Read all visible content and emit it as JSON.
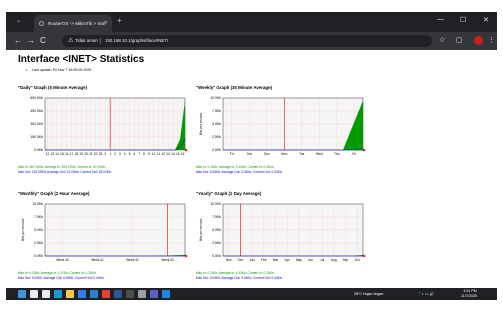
{
  "browser": {
    "tab_title": "RouterOS -> MikroTik > Inte",
    "tab_close": "✕",
    "tab_menu": "⌄",
    "new_tab": "+",
    "window_controls": {
      "minimize": "—",
      "maximize": "☐",
      "close": "✕"
    },
    "nav": {
      "back": "←",
      "forward": "→",
      "reload": "C"
    },
    "security_label": "Tidak aman",
    "url": "192.168.10.1/graphs/iface/INET/",
    "toolbar_icons": {
      "star": "☆",
      "extensions": "▢",
      "menu": "⋮"
    }
  },
  "page": {
    "title": "Interface <INET> Statistics",
    "last_update": "Last update: Fri Nov 7 16:05:09 2025"
  },
  "panels": [
    {
      "title": "\"Daily\" Graph (5 Minute Average)",
      "stats_in": "Max In: 567.00Kb; Average In: 109.27Kb; Current In: 37.02Kb;",
      "stats_out": "Max Out: 129.09Kb; Average Out: 21.00Kb; Current Out: 43.00Kb;",
      "chart_data": {
        "type": "area",
        "y_ticks": [
          "600.0Kb",
          "450.0Kb",
          "300.0Kb",
          "150.0Kb",
          "0.0Kb"
        ],
        "x_ticks": [
          "12",
          "13",
          "14",
          "15",
          "16",
          "17",
          "18",
          "19",
          "20",
          "21",
          "22",
          "23",
          "0",
          "1",
          "2",
          "3",
          "4",
          "5",
          "6",
          "7",
          "8",
          "9",
          "10",
          "11",
          "12",
          "13",
          "14",
          "15",
          "16"
        ],
        "ylim": [
          0,
          600
        ],
        "unit": "Kb",
        "ylabel": "",
        "current_marker_index": 13,
        "series": [
          {
            "name": "In",
            "color": "#009900",
            "values": [
              0,
              0,
              0,
              0,
              0,
              0,
              0,
              0,
              0,
              0,
              0,
              0,
              0,
              0,
              0,
              0,
              0,
              0,
              0,
              0,
              0,
              0,
              0,
              0,
              0,
              0,
              0,
              120,
              567
            ]
          },
          {
            "name": "Out",
            "color": "#0000cc",
            "values": [
              0,
              0,
              0,
              0,
              0,
              0,
              0,
              0,
              0,
              0,
              0,
              0,
              0,
              0,
              0,
              0,
              0,
              0,
              0,
              0,
              0,
              0,
              0,
              0,
              0,
              0,
              0,
              30,
              129
            ]
          }
        ]
      }
    },
    {
      "title": "\"Weekly\" Graph (30 Minute Average)",
      "stats_in": "Max In: 0.11Kb; Average In: 0.11Kb; Current In: 0.11Kb;",
      "stats_out": "Max Out: 0.04Kb; Average Out: 0.04Kb; Current Out: 0.04Kb;",
      "chart_data": {
        "type": "area",
        "y_ticks": [
          "10.0Kb",
          "7.5Kb",
          "5.0Kb",
          "2.5Kb",
          "0.0Kb"
        ],
        "x_ticks": [
          "Fri",
          "Sat",
          "Sun",
          "Mon",
          "Tue",
          "Wed",
          "Thu",
          "Fri"
        ],
        "ylim": [
          0,
          10
        ],
        "unit": "Kb",
        "ylabel": "Bits per second",
        "current_marker_index": 3,
        "series": [
          {
            "name": "In",
            "color": "#009900",
            "values": [
              0,
              0,
              0,
              0,
              0,
              0,
              0,
              9.5
            ]
          },
          {
            "name": "Out",
            "color": "#0000cc",
            "values": [
              0,
              0,
              0,
              0,
              0,
              0,
              0,
              0
            ]
          }
        ]
      }
    },
    {
      "title": "\"Monthly\" Graph (2 Hour Average)",
      "stats_in": "Max In: 0.11Kb; Average In: 0.11Kb; Current In: 0.11Kb;",
      "stats_out": "Max Out: 0.04Kb; Average Out: 0.04Kb; Current Out: 0.04Kb;",
      "chart_data": {
        "type": "area",
        "y_ticks": [
          "10.0Kb",
          "7.5Kb",
          "5.0Kb",
          "2.5Kb",
          "0.0Kb"
        ],
        "x_ticks": [
          "Week 40",
          "Week 41",
          "Week 42",
          "Week 43"
        ],
        "ylim": [
          0,
          10
        ],
        "unit": "Kb",
        "ylabel": "Bits per second",
        "current_marker_index": 3,
        "series": [
          {
            "name": "In",
            "color": "#009900",
            "values": [
              0,
              0,
              0,
              0,
              0.2
            ]
          },
          {
            "name": "Out",
            "color": "#0000cc",
            "values": [
              0,
              0,
              0,
              0,
              0
            ]
          }
        ]
      }
    },
    {
      "title": "\"Yearly\" Graph (1 Day Average)",
      "stats_in": "Max In: 0.11Kb; Average In: 0.11Kb; Current In: 0.11Kb;",
      "stats_out": "Max Out: 0.04Kb; Average Out: 0.04Kb; Current Out: 0.04Kb;",
      "chart_data": {
        "type": "area",
        "y_ticks": [
          "10.0Kb",
          "7.5Kb",
          "5.0Kb",
          "2.5Kb",
          "0.0Kb"
        ],
        "x_ticks": [
          "Nov",
          "Dec",
          "Jan",
          "Feb",
          "Mar",
          "Apr",
          "May",
          "Jun",
          "Jul",
          "Aug",
          "Sep",
          "Oct"
        ],
        "ylim": [
          0,
          10
        ],
        "unit": "Kb",
        "ylabel": "Bits per second",
        "current_marker_index": 1,
        "series": [
          {
            "name": "In",
            "color": "#009900",
            "values": [
              0,
              0,
              0,
              0,
              0,
              0,
              0,
              0,
              0,
              0,
              0,
              0,
              0.2
            ]
          },
          {
            "name": "Out",
            "color": "#0000cc",
            "values": [
              0,
              0,
              0,
              0,
              0,
              0,
              0,
              0,
              0,
              0,
              0,
              0,
              0
            ]
          }
        ]
      }
    }
  ],
  "taskbar": {
    "weather": "28°C Hujan ringan",
    "time": "4:51 PM",
    "date": "11/7/2025",
    "icon_names": [
      "windows-start-icon",
      "search-icon",
      "task-view-icon",
      "edge-icon",
      "file-explorer-icon",
      "store-icon",
      "mail-icon",
      "chrome-icon",
      "word-icon",
      "terminal-icon",
      "settings-icon",
      "teams-icon",
      "browser-icon"
    ],
    "icon_colors": [
      "#3a96dd",
      "#e8eaed",
      "#e8eaed",
      "#0f9fd6",
      "#f2c94c",
      "#2f80ed",
      "#2d7dd2",
      "#e94235",
      "#2b579a",
      "#4d4d4d",
      "#9aa0a6",
      "#5b5fc7",
      "#1e88e5"
    ]
  }
}
